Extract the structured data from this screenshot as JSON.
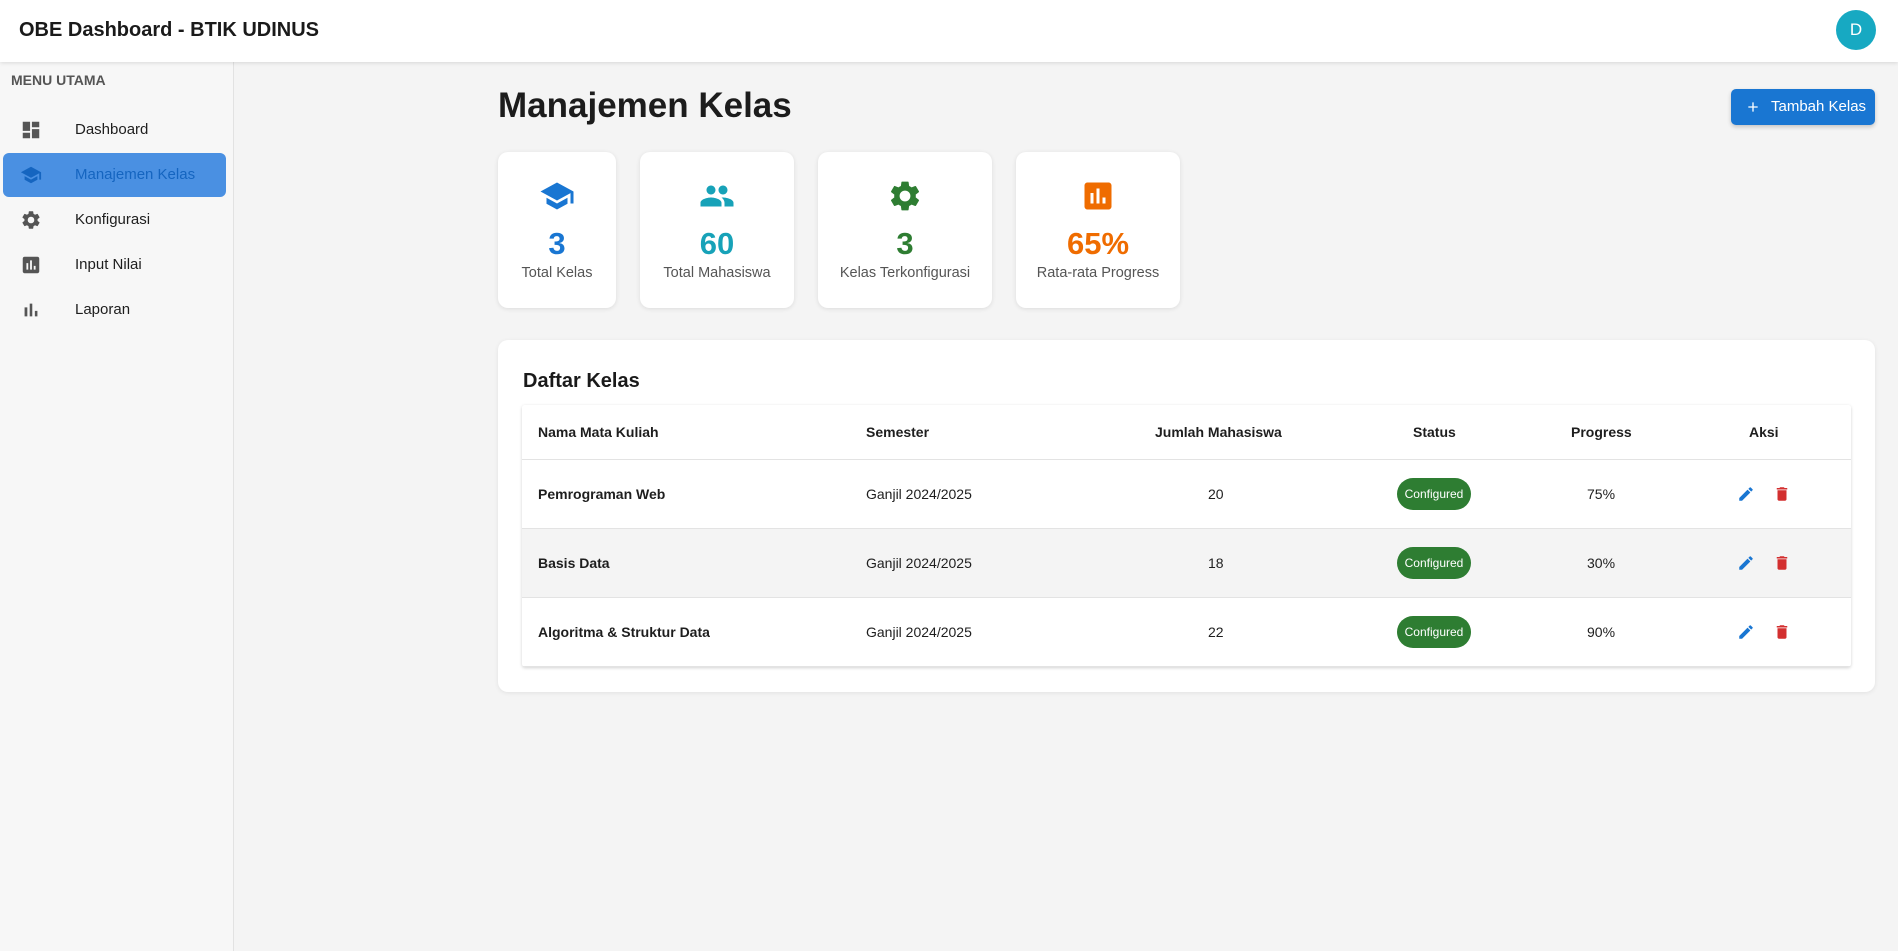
{
  "header": {
    "title": "OBE Dashboard - BTIK UDINUS",
    "avatar_initial": "D"
  },
  "sidebar": {
    "section_title": "MENU UTAMA",
    "items": [
      {
        "label": "Dashboard",
        "icon": "dashboard-icon",
        "active": false
      },
      {
        "label": "Manajemen Kelas",
        "icon": "school-icon",
        "active": true
      },
      {
        "label": "Konfigurasi",
        "icon": "gear-icon",
        "active": false
      },
      {
        "label": "Input Nilai",
        "icon": "assessment-icon",
        "active": false
      },
      {
        "label": "Laporan",
        "icon": "bar-chart-icon",
        "active": false
      }
    ]
  },
  "main": {
    "title": "Manajemen Kelas",
    "add_button_label": "Tambah Kelas",
    "stats": [
      {
        "value": "3",
        "label": "Total Kelas",
        "icon": "school-icon",
        "color": "#1976d2"
      },
      {
        "value": "60",
        "label": "Total Mahasiswa",
        "icon": "people-icon",
        "color": "#17a2b8"
      },
      {
        "value": "3",
        "label": "Kelas Terkonfigurasi",
        "icon": "gear-icon",
        "color": "#2e7d32"
      },
      {
        "value": "65%",
        "label": "Rata-rata Progress",
        "icon": "assessment-icon",
        "color": "#ef6c00"
      }
    ],
    "table": {
      "title": "Daftar Kelas",
      "columns": [
        "Nama Mata Kuliah",
        "Semester",
        "Jumlah Mahasiswa",
        "Status",
        "Progress",
        "Aksi"
      ],
      "rows": [
        {
          "name": "Pemrograman Web",
          "semester": "Ganjil 2024/2025",
          "students": "20",
          "status": "Configured",
          "progress": "75%"
        },
        {
          "name": "Basis Data",
          "semester": "Ganjil 2024/2025",
          "students": "18",
          "status": "Configured",
          "progress": "30%"
        },
        {
          "name": "Algoritma & Struktur Data",
          "semester": "Ganjil 2024/2025",
          "students": "22",
          "status": "Configured",
          "progress": "90%"
        }
      ]
    }
  },
  "colors": {
    "primary": "#1976d2",
    "status_green": "#2e7d32",
    "delete_red": "#d32f2f",
    "avatar": "#17a9c2"
  }
}
